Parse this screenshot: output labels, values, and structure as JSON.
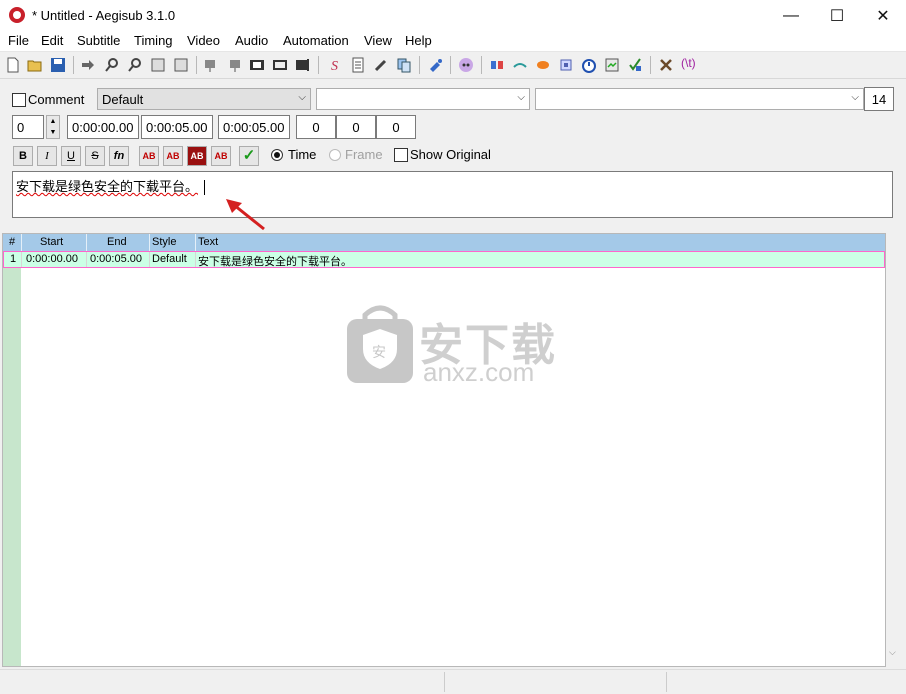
{
  "window": {
    "title": "* Untitled - Aegisub 3.1.0",
    "minimize": "—",
    "maximize": "☐",
    "close": "✕"
  },
  "menu": [
    "File",
    "Edit",
    "Subtitle",
    "Timing",
    "Video",
    "Audio",
    "Automation",
    "View",
    "Help"
  ],
  "toolbar": {
    "icons": [
      "new-file-icon",
      "open-folder-icon",
      "save-icon",
      "jump-to-icon",
      "zoom-in-icon",
      "zoom-out-icon",
      "snap-start-icon",
      "snap-end-icon",
      "video-start-icon",
      "video-end-icon",
      "keyframe-icon",
      "timecode-icon",
      "clip-icon",
      "spellcheck-icon",
      "properties-icon",
      "attachments-icon",
      "fonts-icon",
      "styles-manager-icon",
      "styling-assistant-icon",
      "translation-icon",
      "resample-icon",
      "timing-post-icon",
      "kanji-timer-icon",
      "subtitles-check-icon",
      "options-icon",
      "hotkeys-icon"
    ],
    "tag_label": "(\\t)"
  },
  "editor": {
    "comment_label": "Comment",
    "style": "Default",
    "actor": "",
    "effect": "",
    "layer_count": "14",
    "layer": "0",
    "start_time": "0:00:00.00",
    "end_time": "0:00:05.00",
    "duration": "0:00:05.00",
    "margin_l": "0",
    "margin_r": "0",
    "margin_v": "0",
    "bold": "B",
    "italic": "I",
    "underline": "U",
    "strike": "S",
    "font": "fn",
    "color_labels": [
      "AB",
      "AB",
      "AB",
      "AB"
    ],
    "commit": "✓",
    "time_label": "Time",
    "frame_label": "Frame",
    "show_original_label": "Show Original",
    "text": "安下载是绿色安全的下载平台。"
  },
  "grid": {
    "headers": [
      "#",
      "Start",
      "End",
      "Style",
      "Text"
    ],
    "rows": [
      {
        "num": "1",
        "start": "0:00:00.00",
        "end": "0:00:05.00",
        "style": "Default",
        "text": "安下载是绿色安全的下载平台。"
      }
    ]
  },
  "watermark": {
    "cn": "安下载",
    "en": "anxz.com",
    "shield": "安"
  },
  "colors": {
    "header": "#a4c9e8",
    "selected_row": "#ccffe6",
    "row_border": "#ff66cc",
    "rownum_col": "#c7e6cc",
    "arrow": "#d42020"
  }
}
